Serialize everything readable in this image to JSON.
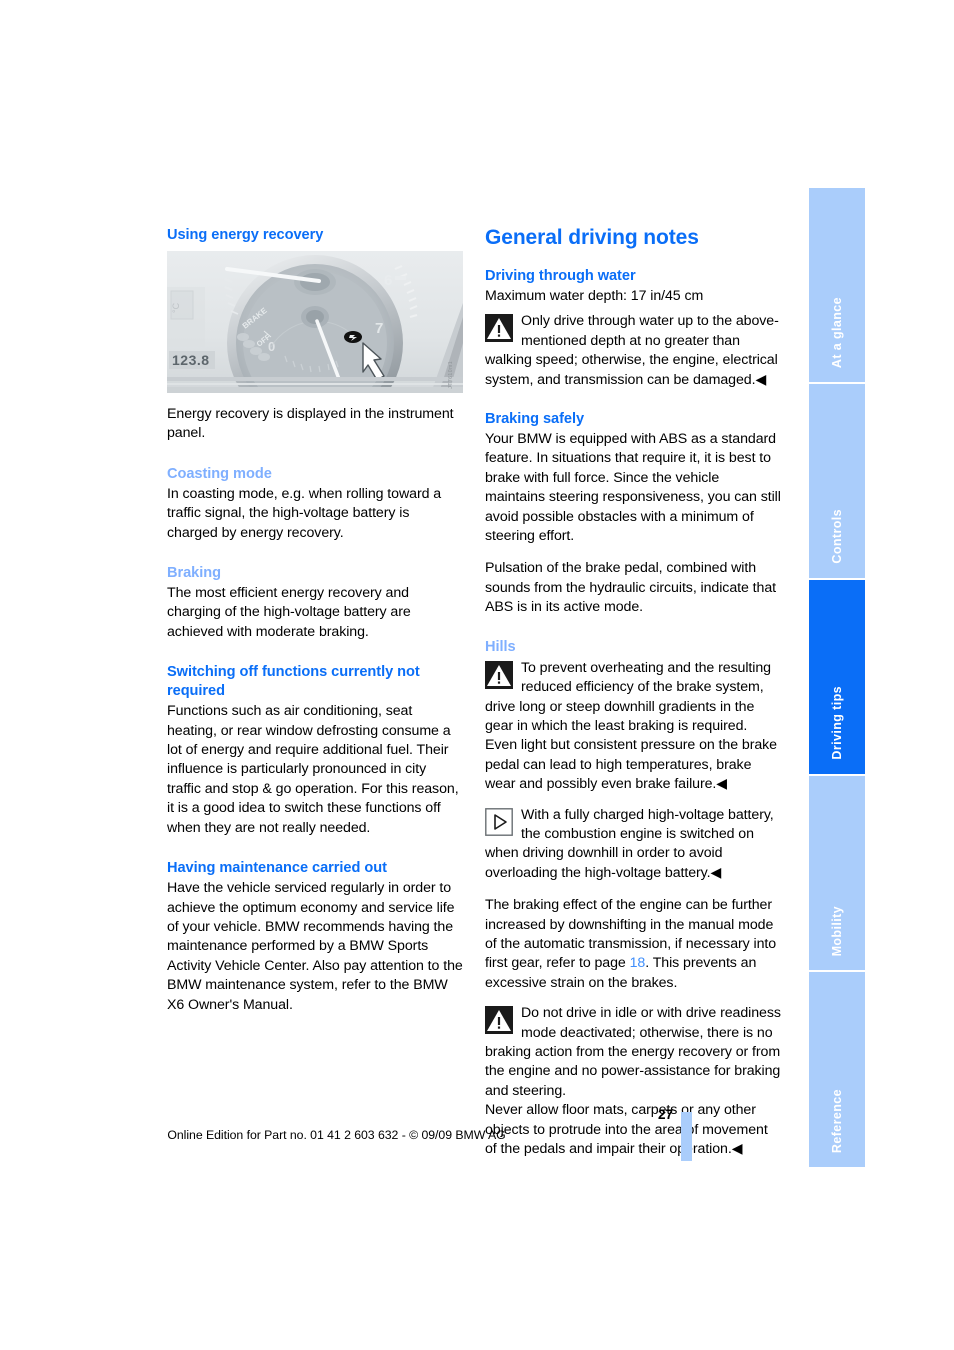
{
  "document": {
    "page_number": "27",
    "footer_text": "Online Edition for Part no. 01 41 2 603 632 - © 09/09 BMW AG"
  },
  "tabs": [
    {
      "label": "At a glance",
      "active": false
    },
    {
      "label": "Controls",
      "active": false
    },
    {
      "label": "Driving tips",
      "active": true
    },
    {
      "label": "Mobility",
      "active": false
    },
    {
      "label": "Reference",
      "active": false
    }
  ],
  "left_column": {
    "heading": "Using energy recovery",
    "figure": {
      "alt": "Instrument panel cluster with tachometer and white arrow pointing to energy recovery indicator",
      "image_code": "JT7610m1"
    },
    "caption": "Energy recovery is displayed in the instrument panel.",
    "sections": [
      {
        "heading": "Coasting mode",
        "heading_style": "light",
        "body": "In coasting mode, e.g. when rolling toward a traffic signal, the high-voltage battery is charged by energy recovery."
      },
      {
        "heading": "Braking",
        "heading_style": "light",
        "body": "The most efficient energy recovery and charging of the high-voltage battery are achieved with moderate braking."
      },
      {
        "heading": "Switching off functions currently not required",
        "heading_style": "strong",
        "body": "Functions such as air conditioning, seat heating, or rear window defrosting consume a lot of energy and require additional fuel. Their influence is particularly pronounced in city traffic and stop & go operation. For this reason, it is a good idea to switch these functions off when they are not really needed."
      },
      {
        "heading": "Having maintenance carried out",
        "heading_style": "strong",
        "body": "Have the vehicle serviced regularly in order to achieve the optimum economy and service life of your vehicle. BMW recommends having the maintenance performed by a BMW Sports Activity Vehicle Center. Also pay attention to the BMW maintenance system, refer to the BMW X6 Owner's Manual."
      }
    ]
  },
  "right_column": {
    "heading": "General driving notes",
    "water": {
      "heading": "Driving through water",
      "body": "Maximum water depth: 17 in/45 cm",
      "warning": "Only drive through water up to the above-mentioned depth at no greater than walking speed; otherwise, the engine, electrical system, and transmission can be damaged.◀"
    },
    "braking": {
      "heading": "Braking safely",
      "paragraph_1": "Your BMW is equipped with ABS as a standard feature. In situations that require it, it is best to brake with full force. Since the vehicle maintains steering responsiveness, you can still avoid possible obstacles with a minimum of steering effort.",
      "paragraph_2": "Pulsation of the brake pedal, combined with sounds from the hydraulic circuits, indicate that ABS is in its active mode."
    },
    "hills": {
      "heading": "Hills",
      "warning_1": "To prevent overheating and the resulting reduced efficiency of the brake system, drive long or steep downhill gradients in the gear in which the least braking is required. Even light but consistent pressure on the brake pedal can lead to high temperatures, brake wear and possibly even brake failure.◀",
      "info_1": "With a fully charged high-voltage battery, the combustion engine is switched on when driving downhill in order to avoid overloading the high-voltage battery.◀",
      "paragraph_before": "The braking effect of the engine can be further increased by downshifting in the manual mode of the automatic transmission, if necessary into first gear, refer to page ",
      "page_link": "18",
      "paragraph_after": ". This prevents an excessive strain on the brakes.",
      "warning_2": "Do not drive in idle or with drive readiness mode deactivated; otherwise, there is no braking action from the energy recovery or from the engine and no power-assistance for braking and steering.",
      "warning_3": "Never allow floor mats, carpets or any other objects to protrude into the area of movement of the pedals and impair their operation.◀"
    }
  },
  "colors": {
    "heading_blue": "#0a6ef7",
    "subheading_light_blue": "#7fafff",
    "tab_inactive": "#aacdfb",
    "tab_active": "#0a6ef7",
    "link_blue": "#3f8efb"
  },
  "icons": {
    "warning": "warning-triangle-icon",
    "info": "info-triangle-icon"
  }
}
